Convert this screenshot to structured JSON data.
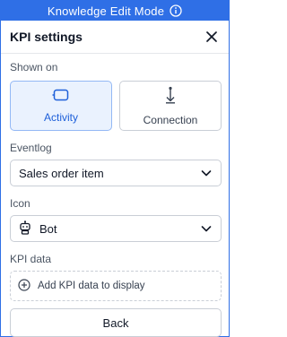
{
  "banner": {
    "text": "Knowledge Edit Mode",
    "icon": "info-icon"
  },
  "header": {
    "title": "KPI settings",
    "close_icon": "close-icon"
  },
  "shown_on": {
    "label": "Shown on",
    "options": [
      {
        "label": "Activity",
        "icon": "activity-icon",
        "selected": true
      },
      {
        "label": "Connection",
        "icon": "connection-icon",
        "selected": false
      }
    ]
  },
  "eventlog": {
    "label": "Eventlog",
    "value": "Sales order item"
  },
  "icon_field": {
    "label": "Icon",
    "value": "Bot",
    "icon": "bot-icon"
  },
  "kpi_data": {
    "label": "KPI data",
    "add_label": "Add KPI data to display"
  },
  "footer": {
    "back_label": "Back"
  },
  "colors": {
    "accent": "#2f6fe6",
    "selected_bg": "#eaf2fe"
  }
}
